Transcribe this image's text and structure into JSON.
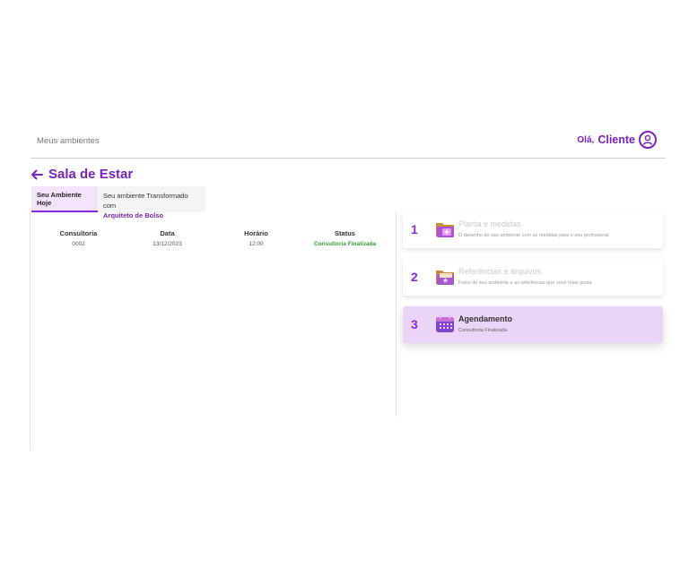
{
  "header": {
    "breadcrumb": "Meus ambientes",
    "greeting": "Olá,",
    "user_name": "Cliente"
  },
  "page": {
    "title": "Sala de Estar"
  },
  "tabs": [
    {
      "label": "Seu Ambiente Hoje",
      "active": true
    },
    {
      "label": "Seu ambiente Transformado com",
      "accent": "Arquiteto de Bolso",
      "active": false
    }
  ],
  "table": {
    "headers": [
      "Consultoria",
      "Data",
      "Horário",
      "Status"
    ],
    "rows": [
      [
        "0002",
        "13/12/2023",
        "12:00",
        "Consultoria Finalizada"
      ]
    ]
  },
  "steps": [
    {
      "number": "1",
      "title": "Planta e medidas",
      "description": "O desenho do seu ambiente com as medidas para o seu profissional",
      "icon": "folder-plus-icon"
    },
    {
      "number": "2",
      "title": "Referências e arquivos",
      "description": "Fotos do seu ambiente e as referências que você mais gosta",
      "icon": "folder-star-icon"
    },
    {
      "number": "3",
      "title": "Agendamento",
      "description": "Consultoria Finalizada",
      "icon": "calendar-icon",
      "active": true
    }
  ],
  "colors": {
    "accent": "#7b22b8",
    "status_done": "#3a9a3a",
    "active_card": "#ead4f8"
  }
}
